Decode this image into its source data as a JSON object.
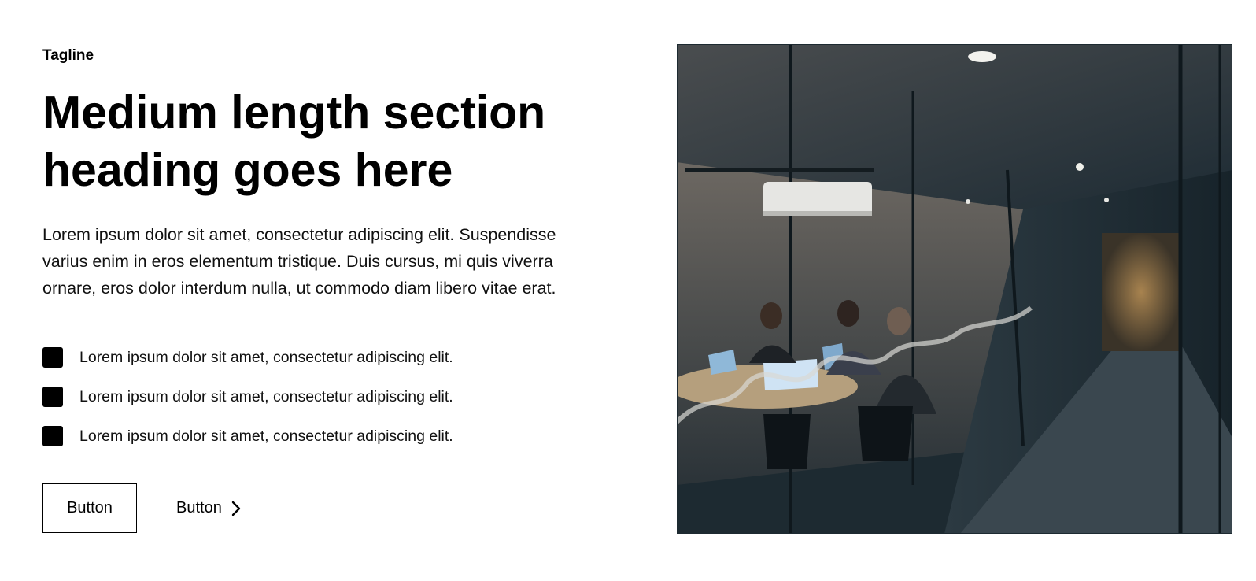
{
  "tagline": "Tagline",
  "heading": "Medium length section heading goes here",
  "description": "Lorem ipsum dolor sit amet, consectetur adipiscing elit. Suspendisse varius enim in eros elementum tristique. Duis cursus, mi quis viverra ornare, eros dolor interdum nulla, ut commodo diam libero vitae erat.",
  "features": [
    {
      "icon": "square-icon",
      "text": "Lorem ipsum dolor sit amet, consectetur adipiscing elit."
    },
    {
      "icon": "square-icon",
      "text": "Lorem ipsum dolor sit amet, consectetur adipiscing elit."
    },
    {
      "icon": "square-icon",
      "text": "Lorem ipsum dolor sit amet, consectetur adipiscing elit."
    }
  ],
  "actions": {
    "secondary_label": "Button",
    "link_label": "Button",
    "link_icon": "chevron-right-icon"
  },
  "colors": {
    "text": "#000000",
    "background": "#ffffff",
    "image_base": "#1d2a31"
  }
}
